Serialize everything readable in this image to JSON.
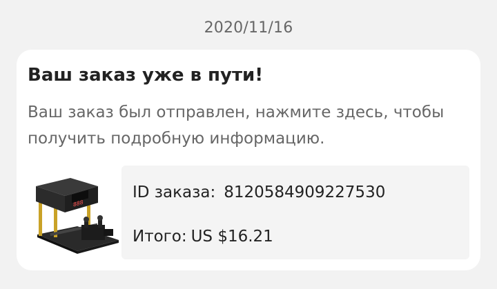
{
  "message": {
    "date": "2020/11/16",
    "title": "Ваш заказ уже в пути!",
    "description": "Ваш заказ был отправлен, нажмите здесь, чтобы получить подробную информацию."
  },
  "order": {
    "id_label": "ID заказа:",
    "id_value": "8120584909227530",
    "total_label": "Итого:",
    "total_value": "US $16.21"
  },
  "product": {
    "display_value": "888",
    "icon": "product-thumbnail-chronograph"
  }
}
